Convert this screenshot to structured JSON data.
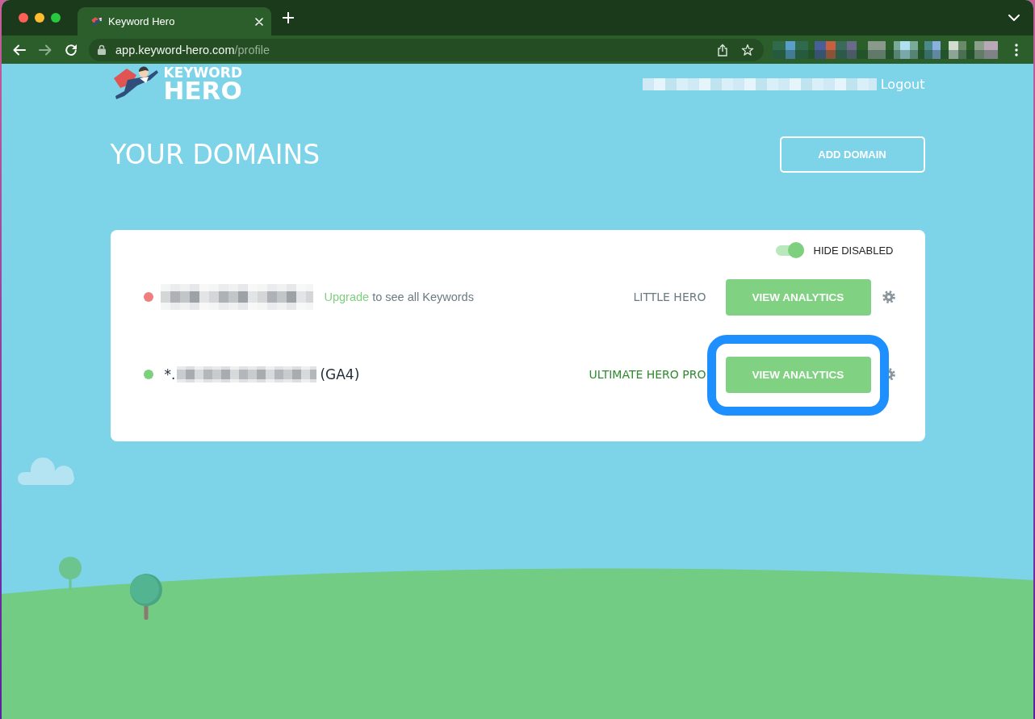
{
  "browser": {
    "tab": {
      "title": "Keyword Hero",
      "selected": true
    },
    "address": {
      "host": "app.keyword-hero.com",
      "path": "/profile"
    }
  },
  "header": {
    "logo": {
      "top": "KEYWORD",
      "bottom": "HERO"
    },
    "logout": "Logout"
  },
  "page": {
    "title": "YOUR DOMAINS",
    "add_button": "ADD DOMAIN"
  },
  "filter_toggle": {
    "label": "HIDE DISABLED",
    "on": true
  },
  "domains": [
    {
      "color": "#ef7f7f",
      "note": {
        "link": "Upgrade",
        "text": "to see all Keywords"
      },
      "plan": {
        "label": "LITTLE HERO",
        "color": "#6b7b83"
      },
      "button": "VIEW ANALYTICS",
      "highlighted": false
    },
    {
      "color": "#7ed07e",
      "prefix": "*.",
      "suffix": "(GA4)",
      "plan": {
        "label": "ULTIMATE HERO PRO",
        "color": "#2e8b2e"
      },
      "button": "VIEW ANALYTICS",
      "highlighted": true
    }
  ]
}
